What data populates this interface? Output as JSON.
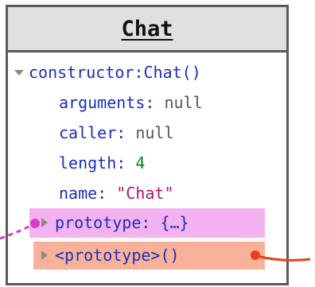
{
  "panel": {
    "title": "Chat"
  },
  "tree": {
    "constructor_label": "constructor:Chat()",
    "properties": [
      {
        "key": "arguments",
        "sep": ": ",
        "value": "null",
        "kind": "null"
      },
      {
        "key": "caller",
        "sep": ": ",
        "value": "null",
        "kind": "null"
      },
      {
        "key": "length",
        "sep": ": ",
        "value": "4",
        "kind": "number"
      },
      {
        "key": "name",
        "sep": ": ",
        "value": "\"Chat\"",
        "kind": "string"
      }
    ],
    "prototype": {
      "key": "prototype",
      "sep": ": ",
      "value": "{…}"
    },
    "inner_prototype": {
      "label": "<prototype>()"
    }
  },
  "colors": {
    "highlight_prototype": "#f5b2f0",
    "highlight_inner_prototype": "#f9b299",
    "connector_pink": "#d63cc8",
    "connector_red": "#e8401a"
  }
}
